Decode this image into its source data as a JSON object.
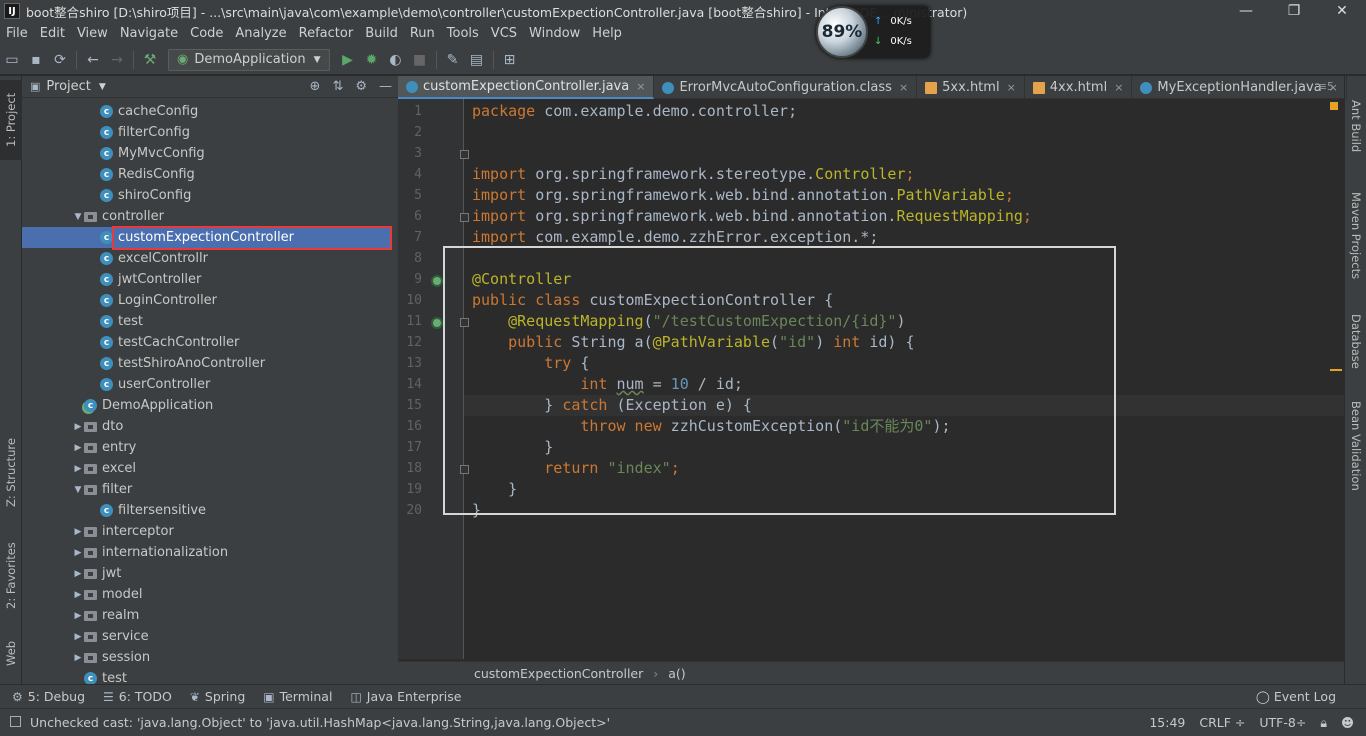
{
  "window": {
    "title": "boot整合shiro [D:\\shiro项目] - ...\\src\\main\\java\\com\\example\\demo\\controller\\customExpectionController.java [boot整合shiro] - IntelliJ IDE... ministrator)",
    "controls": [
      "—",
      "❐",
      "✕"
    ]
  },
  "net_widget": {
    "percent": "89%",
    "up": "0K/s",
    "down": "0K/s"
  },
  "menu": [
    "File",
    "Edit",
    "View",
    "Navigate",
    "Code",
    "Analyze",
    "Refactor",
    "Build",
    "Run",
    "Tools",
    "VCS",
    "Window",
    "Help"
  ],
  "toolbar": {
    "run_config": "DemoApplication"
  },
  "left_stripe": {
    "project": "1: Project",
    "structure": "Z: Structure",
    "favorites": "2: Favorites",
    "web": "Web"
  },
  "right_stripe": {
    "ant": "Ant Build",
    "maven": "Maven Projects",
    "database": "Database",
    "bean": "Bean Validation"
  },
  "project_panel": {
    "title": "Project",
    "tree": [
      {
        "label": "cacheConfig",
        "kind": "class",
        "indent": 3
      },
      {
        "label": "filterConfig",
        "kind": "class",
        "indent": 3
      },
      {
        "label": "MyMvcConfig",
        "kind": "class",
        "indent": 3
      },
      {
        "label": "RedisConfig",
        "kind": "class",
        "indent": 3
      },
      {
        "label": "shiroConfig",
        "kind": "class",
        "indent": 3
      },
      {
        "label": "controller",
        "kind": "folder-open",
        "indent": 2
      },
      {
        "label": "customExpectionController",
        "kind": "class",
        "indent": 3,
        "selected": true
      },
      {
        "label": "excelControllr",
        "kind": "class",
        "indent": 3
      },
      {
        "label": "jwtController",
        "kind": "class",
        "indent": 3
      },
      {
        "label": "LoginController",
        "kind": "class",
        "indent": 3
      },
      {
        "label": "test",
        "kind": "class",
        "indent": 3
      },
      {
        "label": "testCachController",
        "kind": "class",
        "indent": 3
      },
      {
        "label": "testShiroAnoController",
        "kind": "class",
        "indent": 3
      },
      {
        "label": "userController",
        "kind": "class",
        "indent": 3
      },
      {
        "label": "DemoApplication",
        "kind": "app",
        "indent": 2
      },
      {
        "label": "dto",
        "kind": "folder",
        "indent": 2
      },
      {
        "label": "entry",
        "kind": "folder",
        "indent": 2
      },
      {
        "label": "excel",
        "kind": "folder",
        "indent": 2
      },
      {
        "label": "filter",
        "kind": "folder-open",
        "indent": 2
      },
      {
        "label": "filtersensitive",
        "kind": "class",
        "indent": 3
      },
      {
        "label": "interceptor",
        "kind": "folder",
        "indent": 2
      },
      {
        "label": "internationalization",
        "kind": "folder",
        "indent": 2
      },
      {
        "label": "jwt",
        "kind": "folder",
        "indent": 2
      },
      {
        "label": "model",
        "kind": "folder",
        "indent": 2
      },
      {
        "label": "realm",
        "kind": "folder",
        "indent": 2
      },
      {
        "label": "service",
        "kind": "folder",
        "indent": 2
      },
      {
        "label": "session",
        "kind": "folder",
        "indent": 2
      },
      {
        "label": "test",
        "kind": "class",
        "indent": 2
      }
    ]
  },
  "tabs": [
    {
      "label": "customExpectionController.java",
      "icon": "class",
      "active": true
    },
    {
      "label": "ErrorMvcAutoConfiguration.class",
      "icon": "class"
    },
    {
      "label": "5xx.html",
      "icon": "html"
    },
    {
      "label": "4xx.html",
      "icon": "html"
    },
    {
      "label": "MyExceptionHandler.java",
      "icon": "class"
    }
  ],
  "tabs_overflow": "≡5",
  "code_lines": [
    "1",
    "2",
    "3",
    "4",
    "5",
    "6",
    "7",
    "8",
    "9",
    "10",
    "11",
    "12",
    "13",
    "14",
    "15",
    "16",
    "17",
    "18",
    "19",
    "20"
  ],
  "code": {
    "l1_kw": "package",
    "l1_rest": " com.example.demo.controller;",
    "imp": "import",
    "l3_pkg": " org.springframework.stereotype.",
    "l3_cls": "Controller",
    "semi": ";",
    "l4_pkg": " org.springframework.web.bind.annotation.",
    "l4_cls": "PathVariable",
    "l5_pkg": " org.springframework.web.bind.annotation.",
    "l5_cls": "RequestMapping",
    "l6_rest": " com.example.demo.zzhError.exception.*;",
    "l8_an": "@Controller",
    "l9_kw": "public class",
    "l9_rest": " customExpectionController {",
    "l10_an": "@RequestMapping",
    "l10_open": "(",
    "l10_str": "\"/testCustomExpection/{id}\"",
    "l10_close": ")",
    "l11_kw": "public",
    "l11_a": " String a(",
    "l11_an": "@PathVariable",
    "l11_b": "(",
    "l11_str": "\"id\"",
    "l11_c": ") ",
    "l11_kw2": "int",
    "l11_d": " id) {",
    "l12_kw": "try",
    "l12_rest": " {",
    "l13_kw": "int",
    "l13_a": " ",
    "l13_var": "num",
    "l13_b": " = ",
    "l13_num": "10",
    "l13_c": " / id;",
    "l14_a": "} ",
    "l14_kw": "catch",
    "l14_b": " (Exception e) {",
    "l15_kw": "throw new",
    "l15_a": " zzhCustomException(",
    "l15_str": "\"id不能为0\"",
    "l15_b": ");",
    "l16": "}",
    "l17_kw": "return",
    "l17_str": " \"index\"",
    "l17_semi": ";",
    "l18": "}",
    "l19": "}"
  },
  "breadcrumb": [
    "customExpectionController",
    "a()"
  ],
  "bottom_tools": [
    {
      "label": "5: Debug",
      "icon": "⚙"
    },
    {
      "label": "6: TODO",
      "icon": "☰"
    },
    {
      "label": "Spring",
      "icon": "❦"
    },
    {
      "label": "Terminal",
      "icon": "▣"
    },
    {
      "label": "Java Enterprise",
      "icon": "◫"
    }
  ],
  "event_log": "Event Log",
  "status": {
    "message": "Unchecked cast: 'java.lang.Object' to 'java.util.HashMap<java.lang.String,java.lang.Object>'",
    "time": "15:49",
    "line_sep": "CRLF ÷",
    "encoding": "UTF-8÷"
  },
  "colors": {
    "selection": "#4b6eaf",
    "keyword": "#cc7832",
    "annotation": "#bbb529",
    "string": "#6a8759",
    "number": "#6897bb"
  }
}
